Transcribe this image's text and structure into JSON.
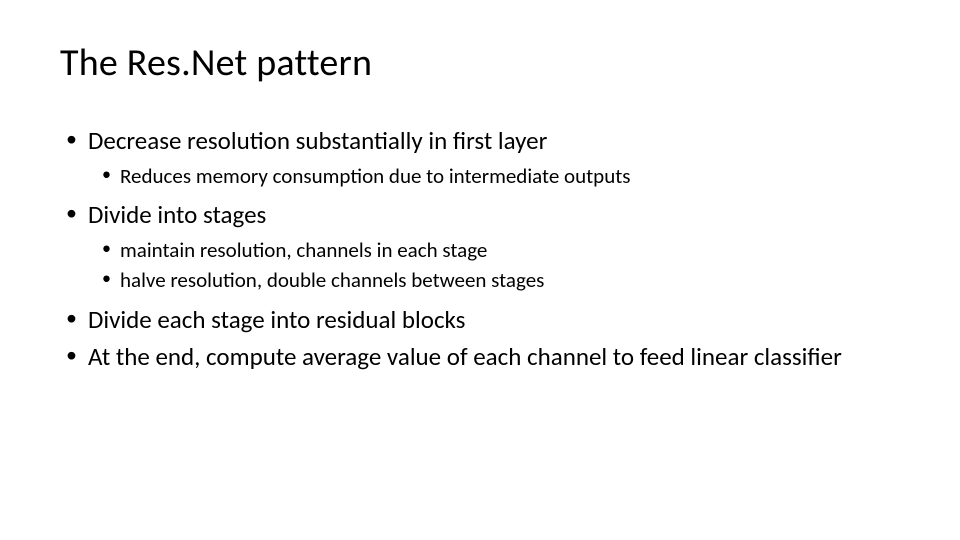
{
  "slide": {
    "title": "The Res.Net pattern",
    "bullets": [
      {
        "level": 1,
        "text": "Decrease resolution substantially in first layer"
      },
      {
        "level": 2,
        "text": "Reduces memory consumption due to intermediate outputs"
      },
      {
        "level": 1,
        "text": "Divide into stages"
      },
      {
        "level": 2,
        "text": "maintain resolution, channels in each stage"
      },
      {
        "level": 2,
        "text": "halve resolution, double channels between stages"
      },
      {
        "level": 1,
        "text": "Divide each stage into residual blocks"
      },
      {
        "level": 1,
        "text": "At the end, compute average value of each channel to feed linear classifier"
      }
    ]
  }
}
